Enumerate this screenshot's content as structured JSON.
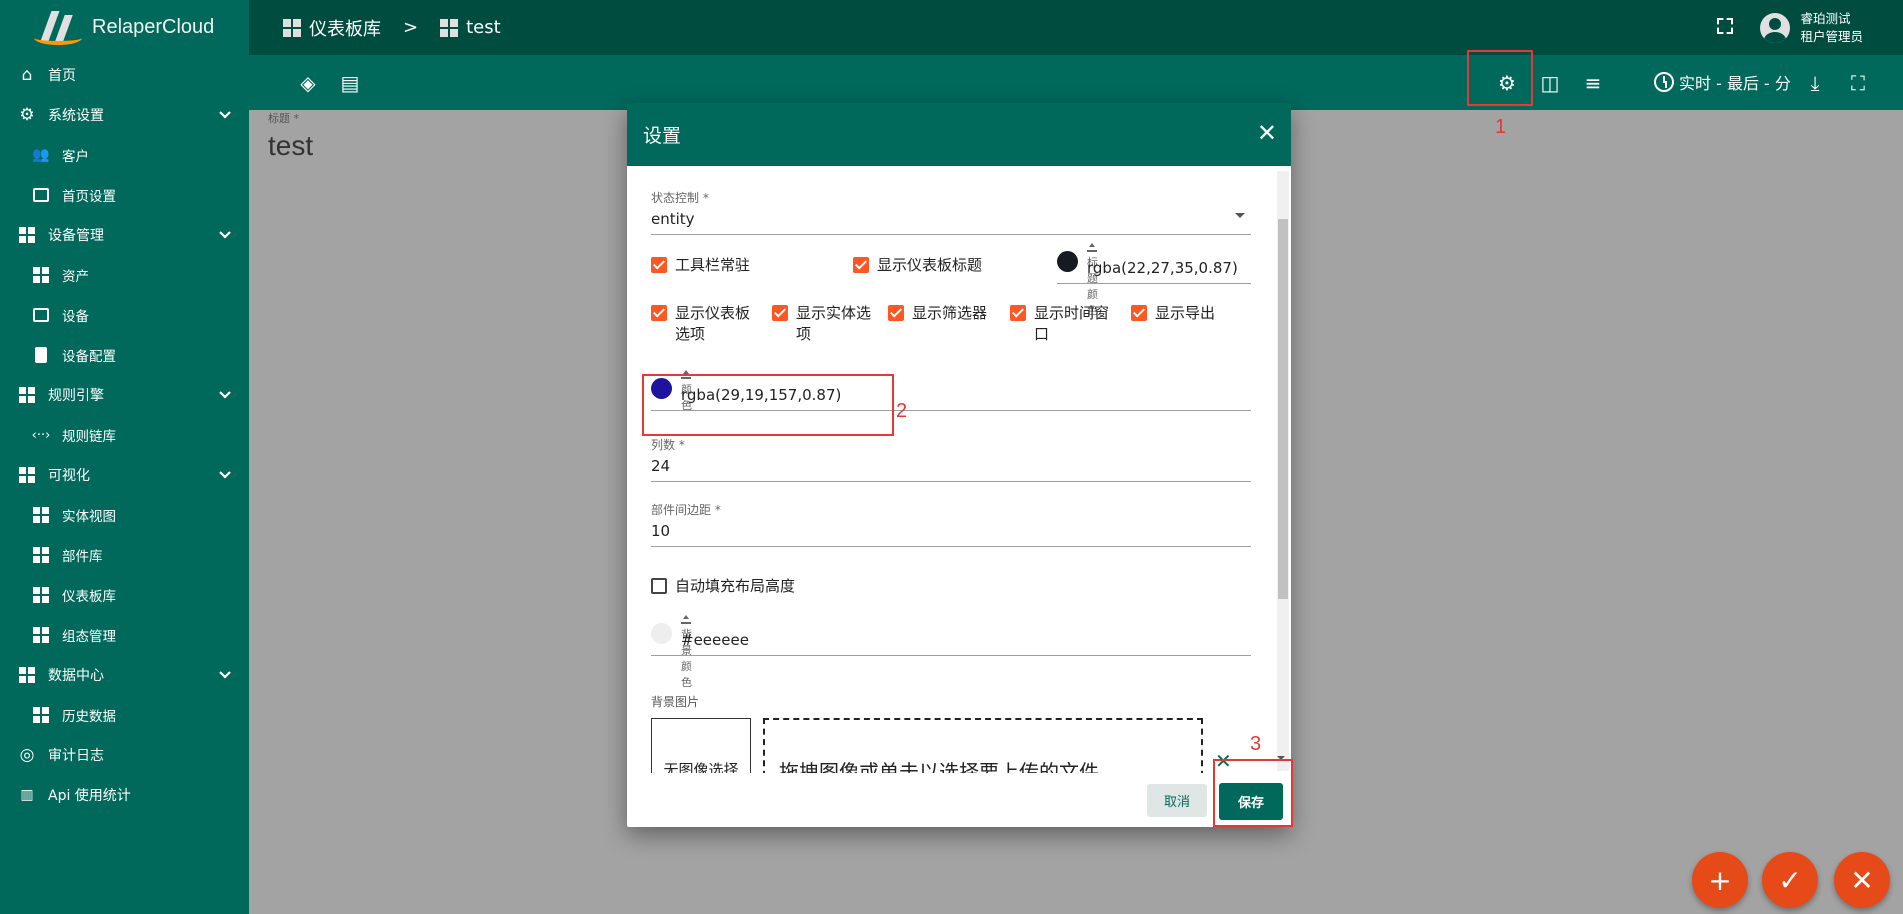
{
  "app": {
    "name": "RelaperCloud"
  },
  "sidebar": {
    "items": [
      {
        "label": "首页",
        "icon": "home-icon"
      },
      {
        "label": "系统设置",
        "icon": "gear-icon",
        "expandable": true
      },
      {
        "label": "客户",
        "icon": "people-icon"
      },
      {
        "label": "首页设置",
        "icon": "settings-box-icon"
      },
      {
        "label": "设备管理",
        "icon": "building-icon",
        "expandable": true
      },
      {
        "label": "资产",
        "icon": "building-icon"
      },
      {
        "label": "设备",
        "icon": "device-icon"
      },
      {
        "label": "设备配置",
        "icon": "profile-icon"
      },
      {
        "label": "规则引擎",
        "icon": "building-icon",
        "expandable": true
      },
      {
        "label": "规则链库",
        "icon": "code-icon"
      },
      {
        "label": "可视化",
        "icon": "building-icon",
        "expandable": true
      },
      {
        "label": "实体视图",
        "icon": "view-icon"
      },
      {
        "label": "部件库",
        "icon": "widgets-icon"
      },
      {
        "label": "仪表板库",
        "icon": "dashboard-icon"
      },
      {
        "label": "组态管理",
        "icon": "dashboard-icon"
      },
      {
        "label": "数据中心",
        "icon": "building-icon",
        "expandable": true
      },
      {
        "label": "历史数据",
        "icon": "view-icon"
      },
      {
        "label": "审计日志",
        "icon": "track-icon"
      },
      {
        "label": "Api 使用统计",
        "icon": "bar-chart-icon"
      }
    ]
  },
  "header": {
    "breadcrumb": [
      "仪表板库",
      "test"
    ],
    "breadcrumb_sep": ">",
    "user": {
      "name": "睿珀测试",
      "role": "租户管理员"
    },
    "time_window": "实时 - 最后 - 分"
  },
  "main": {
    "title_label": "标题 *",
    "title_value": "test"
  },
  "dialog": {
    "title": "设置",
    "state_label": "状态控制 *",
    "state_value": "entity",
    "checkboxes_row1": [
      {
        "label": "工具栏常驻",
        "checked": true
      },
      {
        "label": "显示仪表板标题",
        "checked": true
      }
    ],
    "title_color": {
      "label": "标题颜色",
      "value": "rgba(22,27,35,0.87)",
      "swatch": "#161b23"
    },
    "checkboxes_row2": [
      {
        "label": "显示仪表板选项",
        "checked": true
      },
      {
        "label": "显示实体选项",
        "checked": true
      },
      {
        "label": "显示筛选器",
        "checked": true
      },
      {
        "label": "显示时间窗口",
        "checked": true
      },
      {
        "label": "显示导出",
        "checked": true
      }
    ],
    "color": {
      "label": "颜色",
      "value": "rgba(29,19,157,0.87)",
      "swatch": "#1d139d"
    },
    "columns_label": "列数 *",
    "columns_value": "24",
    "margin_label": "部件间边距 *",
    "margin_value": "10",
    "autofill": {
      "label": "自动填充布局高度",
      "checked": false
    },
    "bg_color": {
      "label": "背景颜色",
      "value": "#eeeeee",
      "swatch": "#eeeeee"
    },
    "bg_image_label": "背景图片",
    "no_image": "无图像选择",
    "dropzone": "拖拽图像或单击以选择要上传的文件。",
    "cancel": "取消",
    "save": "保存"
  },
  "annotations": [
    "1",
    "2",
    "3"
  ],
  "colors": {
    "primary": "#00695c",
    "primary_dark": "#004d40",
    "accent": "#ff5722",
    "fab": "#e64a19",
    "annotation": "#e53935"
  }
}
